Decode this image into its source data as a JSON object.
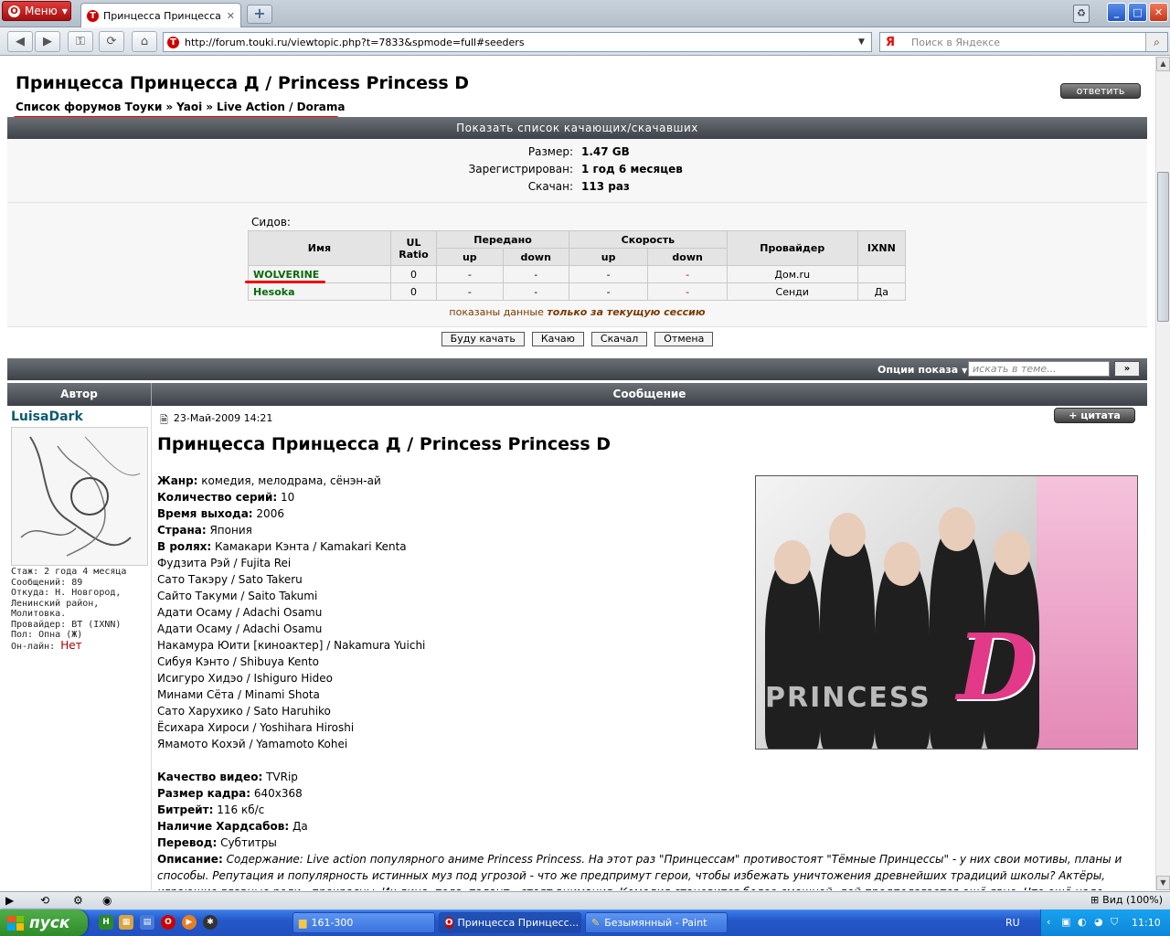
{
  "browser": {
    "menu_label": "Меню",
    "tab_title": "Принцесса Принцесса ...",
    "url": "http://forum.touki.ru/viewtopic.php?t=7833&spmode=full#seeders",
    "search_placeholder": "Поиск в Яндексе",
    "search_engine_glyph": "Я",
    "accent": "#c80f0f"
  },
  "topic": {
    "title": "Принцесса Принцесса Д / Princess Princess D",
    "reply_label": "ответить",
    "breadcrumb": [
      "Список форумов Тоуки",
      "Yaoi",
      "Live Action / Dorama"
    ],
    "breadcrumb_sep": "»"
  },
  "torrent": {
    "header": "Показать список качающих/скачавших",
    "info": [
      {
        "key": "Размер:",
        "value": "1.47 GB"
      },
      {
        "key": "Зарегистрирован:",
        "value": "1 год 6 месяцев"
      },
      {
        "key": "Скачан:",
        "value": "113 раз"
      }
    ],
    "seeds_label": "Сидов:",
    "columns": {
      "name": "Имя",
      "ul_ratio_1": "UL",
      "ul_ratio_2": "Ratio",
      "transferred": "Передано",
      "speed": "Скорость",
      "up": "up",
      "down": "down",
      "provider": "Провайдер",
      "ixnn": "IXNN"
    },
    "peers": [
      {
        "name": "WOLVERINE",
        "ratio": "0",
        "tup": "-",
        "tdown": "-",
        "sup": "-",
        "sdown": "-",
        "provider": "Дом.ru",
        "ixnn": ""
      },
      {
        "name": "Hesoka",
        "ratio": "0",
        "tup": "-",
        "tdown": "-",
        "sup": "-",
        "sdown": "-",
        "provider": "Сенди",
        "ixnn": "Да"
      }
    ],
    "session_note_prefix": "показаны данные",
    "session_note_bold": "только за текущую сессию",
    "buttons": [
      "Буду качать",
      "Качаю",
      "Скачал",
      "Отмена"
    ]
  },
  "options": {
    "label": "Опции показа",
    "search_placeholder": "искать в теме...",
    "go_label": "»"
  },
  "post": {
    "col_author": "Автор",
    "col_message": "Сообщение",
    "author": "LuisaDark",
    "author_info": [
      "Стаж: 2 года 4 месяца",
      "Сообщений: 89",
      "Откуда: Н. Новгород,",
      "Ленинский район,",
      "Молитовка.",
      "Провайдер: ВТ (IXNN)",
      "Пол: Опна (Ж)"
    ],
    "online_label": "Он-лайн:",
    "online_value": "Нет",
    "date": "23-Май-2009 14:21",
    "quote_label": "+ цитата",
    "title": "Принцесса Принцесса Д / Princess Princess D",
    "fields": [
      {
        "k": "Жанр:",
        "v": "комедия, мелодрама, сёнэн-ай"
      },
      {
        "k": "Количество серий:",
        "v": "10"
      },
      {
        "k": "Время выхода:",
        "v": "2006"
      },
      {
        "k": "Страна:",
        "v": "Япония"
      },
      {
        "k": "В ролях:",
        "v": "Камакари Кэнта / Kamakari Kenta"
      }
    ],
    "cast": [
      "Фудзита Рэй / Fujita Rei",
      "Сато Такэру / Sato Takeru",
      "Сайто Такуми / Saito Takumi",
      "Адати Осаму / Adachi Osamu",
      "Адати Осаму / Adachi Osamu",
      "Накамура Юити [киноактер] / Nakamura Yuichi",
      "Сибуя Кэнто / Shibuya Kento",
      "Исигуро Хидэо / Ishiguro Hideo",
      "Минами Сёта / Minami Shota",
      "Сато Харухико / Sato Haruhiko",
      "Ёсихара Хироси / Yoshihara Hiroshi",
      "Ямамото Кохэй / Yamamoto Kohei"
    ],
    "tech": [
      {
        "k": "Качество видео:",
        "v": "TVRip"
      },
      {
        "k": "Размер кадра:",
        "v": "640x368"
      },
      {
        "k": "Битрейт:",
        "v": "116 кб/с"
      },
      {
        "k": "Наличие Хардсабов:",
        "v": "Да"
      },
      {
        "k": "Перевод:",
        "v": "Субтитры"
      }
    ],
    "desc_label": "Описание:",
    "desc_text": "Содержание: Live action популярного аниме Princess Princess. На этот раз \"Принцессам\" противостоят \"Тёмные Принцессы\" - у них свои мотивы, планы и способы. Репутация и популярность истинных муз под угрозой - что же предпримут герои, чтобы избежать уничтожения древнейших традиций школы? Актёры, играющие главные роли - прекрасны. Их лица, тела, талант - стоят внимания. Комедия становится более смешной, дей предполагается ещё явно. Что ещё надо...",
    "poster_letter": "D",
    "poster_text": "PRINCESS"
  },
  "status": {
    "zoom": "Вид (100%)"
  },
  "taskbar": {
    "start": "пуск",
    "items": [
      "161-300",
      "Принцесса Принцесс...",
      "Безымянный - Paint"
    ],
    "lang": "RU",
    "clock": "11:10"
  }
}
